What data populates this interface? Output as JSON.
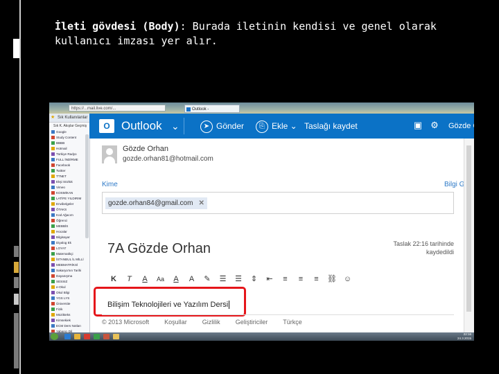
{
  "slide": {
    "caption_strong": "İleti gövdesi (Body)",
    "caption_rest": ": Burada iletinin kendisi ve genel olarak kullanıcı imzası yer alır."
  },
  "browser": {
    "address": "https://...mail.live.com/...",
    "tab_label": "Outlook - gozde.orhan84@..."
  },
  "favorites": {
    "header": "Sık Kullanılanlar",
    "tabs": "Sık K.  Akışlar  Geçmiş",
    "items": [
      "Google",
      "Study Content",
      "BBBB",
      "Hotmail",
      "Türkiye Radyo",
      "FULL İNDİRME",
      "Facebook",
      "Twitter",
      "TTNET",
      "Ekşi Sözlük",
      "Vimeo",
      "KOSMİKAN",
      "LATİFE YILDIRIM",
      "Envibelgeler",
      "ÖTAKS",
      "Kod Ağacım",
      "Öğrenci",
      "MEBBİS",
      "Hocalar",
      "Bilgisayar",
      "Diyalog Ek",
      "LOYAT",
      "Matematikçi",
      "İSTANBUL İL MİLLİ",
      "MEBMATRİKSİ",
      "Sakarya'nın Tarihi",
      "Dayanışma",
      "SESSIZ",
      "e-Okul",
      "Okul Bilgi",
      "YGS LYS",
      "Üniversite",
      "Fizik",
      "Müzikteks",
      "Kimsekiek",
      "ECM Ders Notları",
      "Yabancı Dil",
      "TANITIM",
      "Envan",
      "SERENDİPLİK SAYFA",
      "UÇİİNCİ ABONE"
    ]
  },
  "outlook": {
    "logo_letter": "O",
    "app_name": "Outlook",
    "send": "Gönder",
    "attach": "Ekle",
    "save_draft": "Taslağı kaydet",
    "account_short": "Gözde O",
    "from_name": "Gözde Orhan",
    "from_email": "gozde.orhan81@hotmail.com",
    "to_label": "Kime",
    "bcc_link": "Bilgi Gizli",
    "recipient": "gozde.orhan84@gmail.com",
    "subject": "7A Gözde Orhan",
    "draft_status": "Taslak 22:16 tarihinde kaydedildi",
    "toolbar": [
      "K",
      "T",
      "A",
      "Aa",
      "A",
      "A",
      "✎",
      "☰",
      "☰",
      "⇕",
      "⇤",
      "≡",
      "≡",
      "≡",
      "⛓",
      "☺"
    ],
    "body": "Bilişim Teknolojileri ve Yazılım Dersi",
    "footer": [
      "© 2013 Microsoft",
      "Koşullar",
      "Gizlilik",
      "Geliştiriciler",
      "Türkçe"
    ]
  },
  "taskbar": {
    "time": "22:16",
    "date": "24.3.2015"
  },
  "colors": {
    "outlook_blue": "#0b72c6",
    "highlight_red": "#e5151a"
  }
}
